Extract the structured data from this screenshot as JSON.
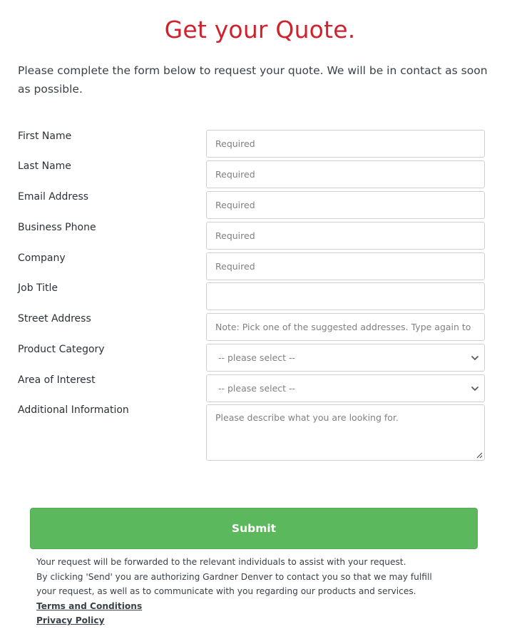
{
  "page": {
    "title": "Get your Quote.",
    "intro": "Please complete the form below to request your quote. We will be in contact as soon as possible.",
    "title_color": "#d0222d"
  },
  "form": {
    "fields": [
      {
        "label": "First Name",
        "type": "text",
        "value": "",
        "placeholder": "Required"
      },
      {
        "label": "Last Name",
        "type": "text",
        "value": "",
        "placeholder": "Required"
      },
      {
        "label": "Email Address",
        "type": "text",
        "value": "",
        "placeholder": "Required"
      },
      {
        "label": "Business Phone",
        "type": "text",
        "value": "",
        "placeholder": "Required"
      },
      {
        "label": "Company",
        "type": "text",
        "value": "",
        "placeholder": "Required"
      },
      {
        "label": "Job Title",
        "type": "text",
        "value": "",
        "placeholder": ""
      },
      {
        "label": "Street Address",
        "type": "text",
        "value": "",
        "placeholder": "Note: Pick one of the suggested addresses. Type again to"
      },
      {
        "label": "Product Category",
        "type": "select",
        "selected": "-- please select --",
        "icon": "chevron-down-icon"
      },
      {
        "label": "Area of Interest",
        "type": "select",
        "selected": "-- please select --",
        "icon": "chevron-down-icon"
      },
      {
        "label": "Additional Information",
        "type": "textarea",
        "value": "",
        "placeholder": "Please describe what you are looking for."
      }
    ],
    "submit_label": "Submit",
    "submit_color": "#5cb85c"
  },
  "disclaimer": {
    "lines": [
      "Your request will be forwarded to the relevant individuals to assist with your request.",
      "By clicking 'Send' you are authorizing Gardner Denver to contact you so that we may fulfill",
      "your request, as well as to communicate with you regarding our products and services."
    ],
    "links": [
      {
        "label": "Terms and Conditions"
      },
      {
        "label": "Privacy Policy"
      }
    ]
  }
}
